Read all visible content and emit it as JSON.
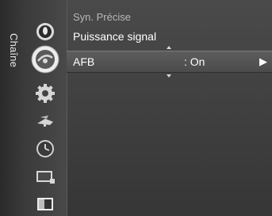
{
  "side_tab": {
    "label": "Chaîne"
  },
  "nav_icons": [
    {
      "name": "picture-icon"
    },
    {
      "name": "channel-antenna-icon"
    },
    {
      "name": "setup-gear-icon"
    },
    {
      "name": "input-icon"
    },
    {
      "name": "clock-icon"
    },
    {
      "name": "application-icon"
    },
    {
      "name": "support-icon"
    }
  ],
  "menu": {
    "items": [
      {
        "label": "Syn. Précise",
        "state": "dimmed"
      },
      {
        "label": "Puissance signal",
        "state": "normal"
      },
      {
        "label": "AFB",
        "value": ": On",
        "state": "selected",
        "arrow": "▶"
      }
    ]
  },
  "colors": {
    "selected_row": "#555555",
    "background": "#3f3f3f",
    "text": "#ffffff",
    "dim_text": "#b8b8b8"
  }
}
